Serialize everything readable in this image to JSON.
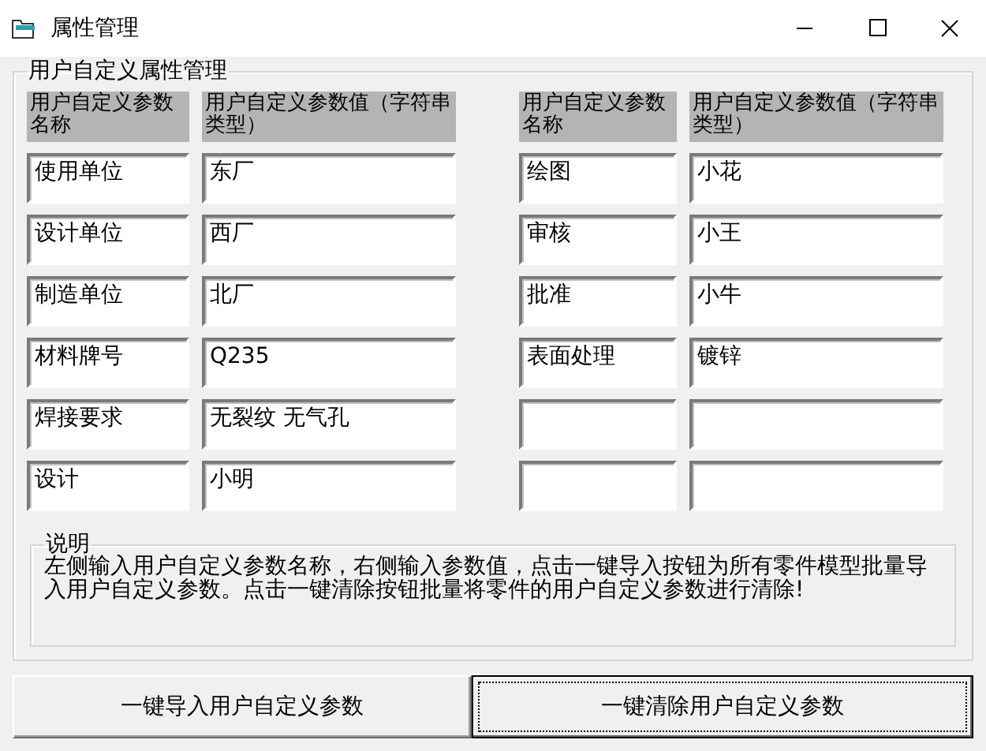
{
  "window": {
    "title": "属性管理"
  },
  "group": {
    "title": "用户自定义属性管理",
    "headers": [
      "用户自定义参数名称",
      "用户自定义参数值（字符串类型）",
      "用户自定义参数名称",
      "用户自定义参数值（字符串类型）"
    ],
    "rows": [
      {
        "left": {
          "name": "使用单位",
          "value": "东厂"
        },
        "right": {
          "name": "绘图",
          "value": "小花"
        }
      },
      {
        "left": {
          "name": "设计单位",
          "value": "西厂"
        },
        "right": {
          "name": "审核",
          "value": "小王"
        }
      },
      {
        "left": {
          "name": "制造单位",
          "value": "北厂"
        },
        "right": {
          "name": "批准",
          "value": "小牛"
        }
      },
      {
        "left": {
          "name": "材料牌号",
          "value": "Q235"
        },
        "right": {
          "name": "表面处理",
          "value": "镀锌"
        }
      },
      {
        "left": {
          "name": "焊接要求",
          "value": "无裂纹 无气孔"
        },
        "right": {}
      },
      {
        "left": {
          "name": "设计",
          "value": "小明"
        },
        "right": {}
      }
    ],
    "note": {
      "title": "说明",
      "text": "左侧输入用户自定义参数名称，右侧输入参数值，点击一键导入按钮为所有零件模型批量导入用户自定义参数。点击一键清除按钮批量将零件的用户自定义参数进行清除!"
    }
  },
  "buttons": [
    {
      "label": "一键导入用户自定义参数",
      "focused": false
    },
    {
      "label": "一键清除用户自定义参数",
      "focused": true
    }
  ]
}
